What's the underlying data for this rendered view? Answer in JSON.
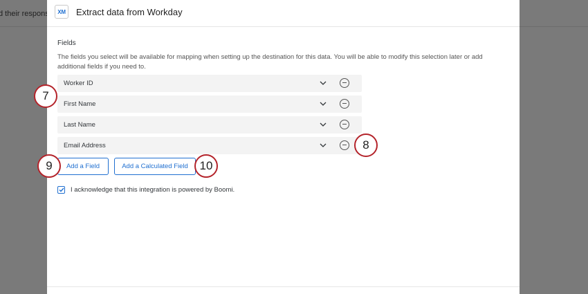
{
  "background": {
    "partial_text": "d their response"
  },
  "modal": {
    "logo_text": "XM",
    "title": "Extract data from Workday",
    "section_label": "Fields",
    "description": "The fields you select will be available for mapping when setting up the destination for this data. You will be able to modify this selection later or add additional fields if you need to.",
    "fields": [
      {
        "label": "Worker ID"
      },
      {
        "label": "First Name"
      },
      {
        "label": "Last Name"
      },
      {
        "label": "Email Address"
      }
    ],
    "add_field_label": "Add a Field",
    "add_calculated_field_label": "Add a Calculated Field",
    "acknowledgement": {
      "checked": true,
      "label": "I acknowledge that this integration is powered by Boomi."
    }
  },
  "callouts": [
    "7",
    "8",
    "9",
    "10"
  ],
  "colors": {
    "accent": "#1f6fd0",
    "callout_border": "#b4232a",
    "overlay": "#7a7a7a"
  }
}
